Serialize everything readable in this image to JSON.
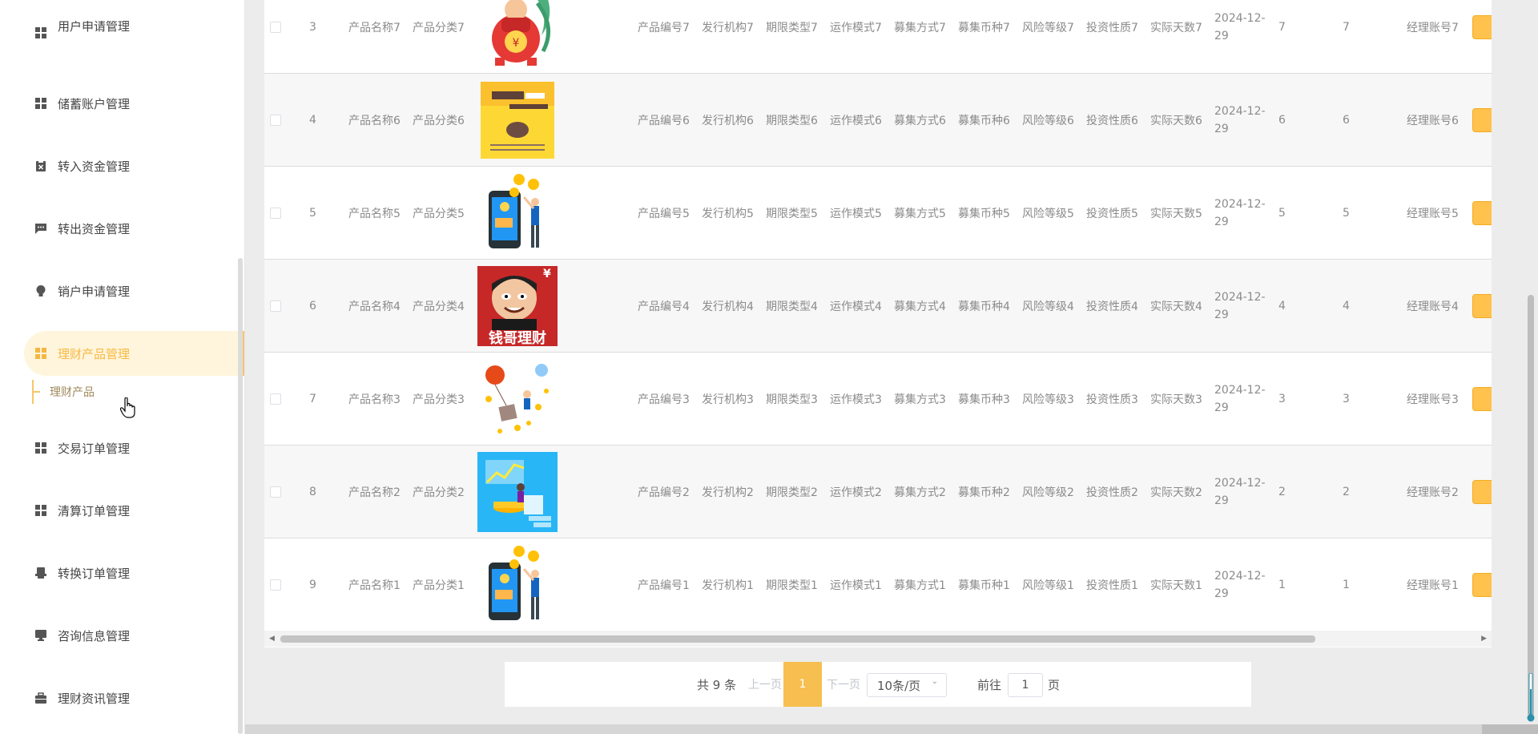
{
  "sidebar": {
    "partial_item": {
      "label": "用户申请管理"
    },
    "items": [
      {
        "label": "储蓄账户管理",
        "icon": "grid-icon"
      },
      {
        "label": "转入资金管理",
        "icon": "clipboard-x-icon"
      },
      {
        "label": "转出资金管理",
        "icon": "chat-icon"
      },
      {
        "label": "销户申请管理",
        "icon": "bulb-icon"
      },
      {
        "label": "理财产品管理",
        "icon": "grid-icon",
        "active": true
      },
      {
        "label": "交易订单管理",
        "icon": "grid-icon"
      },
      {
        "label": "清算订单管理",
        "icon": "grid-icon"
      },
      {
        "label": "转换订单管理",
        "icon": "printer-icon"
      },
      {
        "label": "咨询信息管理",
        "icon": "monitor-icon"
      },
      {
        "label": "理财资讯管理",
        "icon": "briefcase-icon"
      }
    ],
    "submenu": {
      "label": "理财产品"
    }
  },
  "table": {
    "rows": [
      {
        "index": "3",
        "name": "产品名称7",
        "category": "产品分类7",
        "image": "red-envelope-illustration",
        "code": "产品编号7",
        "issuer": "发行机构7",
        "term": "期限类型7",
        "mode": "运作模式7",
        "raise": "募集方式7",
        "currency": "募集币种7",
        "risk": "风险等级7",
        "nature": "投资性质7",
        "days": "实际天数7",
        "date": "2024-12-29",
        "n1": "7",
        "n2": "7",
        "manager": "经理账号7"
      },
      {
        "index": "4",
        "name": "产品名称6",
        "category": "产品分类6",
        "image": "finance-book-cover",
        "code": "产品编号6",
        "issuer": "发行机构6",
        "term": "期限类型6",
        "mode": "运作模式6",
        "raise": "募集方式6",
        "currency": "募集币种6",
        "risk": "风险等级6",
        "nature": "投资性质6",
        "days": "实际天数6",
        "date": "2024-12-29",
        "n1": "6",
        "n2": "6",
        "manager": "经理账号6"
      },
      {
        "index": "5",
        "name": "产品名称5",
        "category": "产品分类5",
        "image": "phone-coins-illustration",
        "code": "产品编号5",
        "issuer": "发行机构5",
        "term": "期限类型5",
        "mode": "运作模式5",
        "raise": "募集方式5",
        "currency": "募集币种5",
        "risk": "风险等级5",
        "nature": "投资性质5",
        "days": "实际天数5",
        "date": "2024-12-29",
        "n1": "5",
        "n2": "5",
        "manager": "经理账号5"
      },
      {
        "index": "6",
        "name": "产品名称4",
        "category": "产品分类4",
        "image": "money-man-poster",
        "poster_text": "钱哥理财",
        "code": "产品编号4",
        "issuer": "发行机构4",
        "term": "期限类型4",
        "mode": "运作模式4",
        "raise": "募集方式4",
        "currency": "募集币种4",
        "risk": "风险等级4",
        "nature": "投资性质4",
        "days": "实际天数4",
        "date": "2024-12-29",
        "n1": "4",
        "n2": "4",
        "manager": "经理账号4"
      },
      {
        "index": "7",
        "name": "产品名称3",
        "category": "产品分类3",
        "image": "balloon-coins-illustration",
        "code": "产品编号3",
        "issuer": "发行机构3",
        "term": "期限类型3",
        "mode": "运作模式3",
        "raise": "募集方式3",
        "currency": "募集币种3",
        "risk": "风险等级3",
        "nature": "投资性质3",
        "days": "实际天数3",
        "date": "2024-12-29",
        "n1": "3",
        "n2": "3",
        "manager": "经理账号3"
      },
      {
        "index": "8",
        "name": "产品名称2",
        "category": "产品分类2",
        "image": "finance-chart-illustration",
        "code": "产品编号2",
        "issuer": "发行机构2",
        "term": "期限类型2",
        "mode": "运作模式2",
        "raise": "募集方式2",
        "currency": "募集币种2",
        "risk": "风险等级2",
        "nature": "投资性质2",
        "days": "实际天数2",
        "date": "2024-12-29",
        "n1": "2",
        "n2": "2",
        "manager": "经理账号2"
      },
      {
        "index": "9",
        "name": "产品名称1",
        "category": "产品分类1",
        "image": "phone-coins-illustration",
        "code": "产品编号1",
        "issuer": "发行机构1",
        "term": "期限类型1",
        "mode": "运作模式1",
        "raise": "募集方式1",
        "currency": "募集币种1",
        "risk": "风险等级1",
        "nature": "投资性质1",
        "days": "实际天数1",
        "date": "2024-12-29",
        "n1": "1",
        "n2": "1",
        "manager": "经理账号1"
      }
    ]
  },
  "pagination": {
    "total": "共 9 条",
    "prev": "上一页",
    "current": "1",
    "next": "下一页",
    "page_size": "10条/页",
    "goto_label": "前往",
    "goto_value": "1",
    "page_unit": "页"
  },
  "colors": {
    "accent": "#f7bf50",
    "active_bg": "#fff5dc",
    "active_text": "#f7b944",
    "op_button": "#ffc24d"
  }
}
